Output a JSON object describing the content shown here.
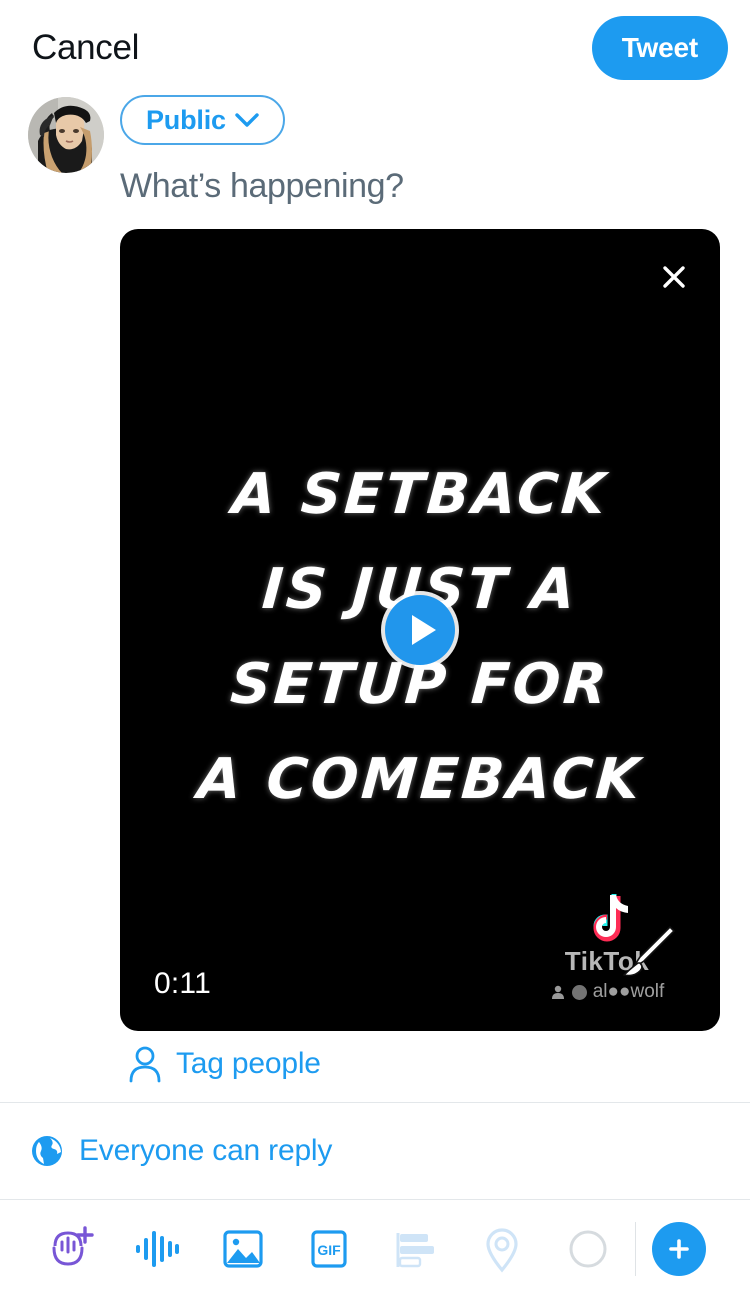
{
  "topbar": {
    "cancel_label": "Cancel",
    "tweet_label": "Tweet"
  },
  "composer": {
    "audience_label": "Public",
    "placeholder": "What’s happening?",
    "avatar_alt": "user-avatar"
  },
  "media": {
    "duration": "0:11",
    "close_label": "×",
    "overlay_lines": [
      "A SETBACK",
      "IS JUST A",
      "SETUP FOR",
      "A COMEBACK"
    ],
    "watermark_word": "TikTok",
    "watermark_user": "al●●wolf"
  },
  "tag_people": {
    "label": "Tag people"
  },
  "reply_settings": {
    "label": "Everyone can reply"
  },
  "toolbar": {
    "items": [
      {
        "name": "spaces-add-icon",
        "label": "Spaces",
        "state": "enabled"
      },
      {
        "name": "audio-waveform-icon",
        "label": "Voice",
        "state": "enabled"
      },
      {
        "name": "image-icon",
        "label": "Media",
        "state": "enabled"
      },
      {
        "name": "gif-icon",
        "label": "GIF",
        "state": "enabled"
      },
      {
        "name": "poll-icon",
        "label": "Poll",
        "state": "disabled"
      },
      {
        "name": "location-pin-icon",
        "label": "Location",
        "state": "disabled"
      },
      {
        "name": "character-count-icon",
        "label": "Character count",
        "state": "disabled"
      }
    ],
    "gif_label": "GIF",
    "add_label": "+"
  },
  "colors": {
    "accent": "#1d9bf0",
    "accent_soft": "#4ba7e8",
    "text_primary": "#0f1419",
    "text_muted": "#5b6b78",
    "divider": "#e3e7ea",
    "disabled": "#cfe4f7",
    "purple": "#7856d6",
    "video_bg": "#000000"
  }
}
